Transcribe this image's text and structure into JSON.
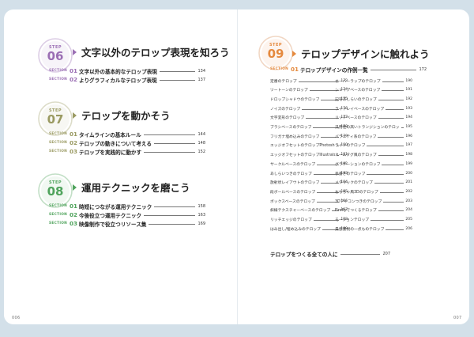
{
  "colors": {
    "step06": "#9b6fb4",
    "step07": "#9a9a62",
    "step08": "#4fa35c",
    "step09": "#e58a3f"
  },
  "left": {
    "chapters": [
      {
        "step_word": "STEP",
        "step_num": "06",
        "title": "文字以外のテロップ表現を知ろう",
        "sections": [
          {
            "label": "SECTION",
            "num": "01",
            "title": "文字以外の基本的なテロップ表現",
            "page": "134"
          },
          {
            "label": "SECTION",
            "num": "02",
            "title": "よりグラフィカルなテロップ表現",
            "page": "137"
          }
        ]
      },
      {
        "step_word": "STEP",
        "step_num": "07",
        "title": "テロップを動かそう",
        "sections": [
          {
            "label": "SECTION",
            "num": "01",
            "title": "タイムラインの基本ルール",
            "page": "144"
          },
          {
            "label": "SECTION",
            "num": "02",
            "title": "テロップの動きについて考える",
            "page": "148"
          },
          {
            "label": "SECTION",
            "num": "03",
            "title": "テロップを実践的に動かす",
            "page": "152"
          }
        ]
      },
      {
        "step_word": "STEP",
        "step_num": "08",
        "title": "運用テクニックを磨こう",
        "sections": [
          {
            "label": "SECTION",
            "num": "01",
            "title": "時短につながる運用テクニック",
            "page": "158"
          },
          {
            "label": "SECTION",
            "num": "02",
            "title": "今後役立つ運用テクニック",
            "page": "163"
          },
          {
            "label": "SECTION",
            "num": "03",
            "title": "映像制作で役立つリソース集",
            "page": "169"
          }
        ]
      }
    ],
    "folio": "006"
  },
  "right": {
    "step_word": "STEP",
    "step_num": "09",
    "title": "テロップデザインに触れよう",
    "section": {
      "label": "SECTION",
      "num": "01",
      "title": "テロップデザインの作例一覧",
      "page": "172"
    },
    "col1": [
      {
        "title": "定番のテロップ",
        "page": "173"
      },
      {
        "title": "ツートーンのテロップ",
        "page": "174"
      },
      {
        "title": "ドロップシャドウのテロップ",
        "page": "175"
      },
      {
        "title": "ノイズのテロップ",
        "page": "176"
      },
      {
        "title": "文字変形のテロップ",
        "page": "177"
      },
      {
        "title": "ブラシベースのテロップ",
        "page": "178"
      },
      {
        "title": "フリガナ埋め込みのテロップ",
        "page": "179"
      },
      {
        "title": "エッジオフセットのテロップPhotoshop 版",
        "page": "180"
      },
      {
        "title": "エッジオフセットのテロップIllustrator 版",
        "page": "181"
      },
      {
        "title": "サークルベースのテロップ",
        "page": "182"
      },
      {
        "title": "あしらいつきのテロップ",
        "page": "183"
      },
      {
        "title": "放射状レイアウトのテロップ",
        "page": "184"
      },
      {
        "title": "段ボールベースのテロップ",
        "page": "185"
      },
      {
        "title": "ボックスベースのテロップ",
        "page": "186"
      },
      {
        "title": "斜線テクスチャーベースのテロップ",
        "page": "187"
      },
      {
        "title": "リッチエッジのテロップ",
        "page": "188"
      },
      {
        "title": "はみ出し/埋め込みのテロップ",
        "page": "189"
      }
    ],
    "col2": [
      {
        "title": "オーバーラップのテロップ",
        "page": "190"
      },
      {
        "title": "シェイプベースのテロップ",
        "page": "191"
      },
      {
        "title": "記号あしらいのテロップ",
        "page": "192"
      },
      {
        "title": "ライトレイベースのテロップ",
        "page": "193"
      },
      {
        "title": "リッチベースのテロップ",
        "page": "194"
      },
      {
        "title": "汎用性の高いトランジションのテロップ",
        "page": "195"
      },
      {
        "title": "バラエティ系のテロップ",
        "page": "196"
      },
      {
        "title": "ラインのテロップ",
        "page": "197"
      },
      {
        "title": "ネームタグ風のテロップ",
        "page": "198"
      },
      {
        "title": "グラデーションのテロップ",
        "page": "199"
      },
      {
        "title": "手書きのテロップ",
        "page": "200"
      },
      {
        "title": "メタリックのテロップ",
        "page": "201"
      },
      {
        "title": "おもちゃ風3Dのテロップ",
        "page": "202"
      },
      {
        "title": "3Dアイコンつきのテロップ",
        "page": "203"
      },
      {
        "title": "Fireflyでつくるテロップ",
        "page": "204"
      },
      {
        "title": "モーションテロップ",
        "page": "205"
      },
      {
        "title": "貴感重視の一点ものテロップ",
        "page": "206"
      }
    ],
    "footer_title": "テロップをつくる全ての人に",
    "footer_page": "207",
    "folio": "007"
  }
}
